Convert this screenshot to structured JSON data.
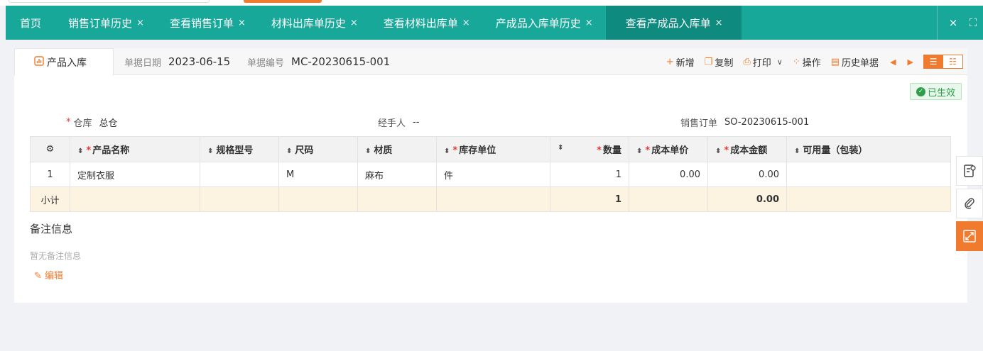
{
  "tabs": [
    {
      "label": "首页",
      "closable": false,
      "active": false
    },
    {
      "label": "销售订单历史",
      "closable": true,
      "active": false
    },
    {
      "label": "查看销售订单",
      "closable": true,
      "active": false
    },
    {
      "label": "材料出库单历史",
      "closable": true,
      "active": false
    },
    {
      "label": "查看材料出库单",
      "closable": true,
      "active": false
    },
    {
      "label": "产成品入库单历史",
      "closable": true,
      "active": false
    },
    {
      "label": "查看产成品入库单",
      "closable": true,
      "active": true
    }
  ],
  "tab_close_glyph": "×",
  "tabbar_controls": {
    "close": "×",
    "fullscreen": "⛶"
  },
  "subtab": {
    "label": "产品入库",
    "icon": "chart-icon"
  },
  "meta": {
    "date_label": "单据日期",
    "date_value": "2023-06-15",
    "number_label": "单据编号",
    "number_value": "MC-20230615-001"
  },
  "toolbar": {
    "new": "新增",
    "copy": "复制",
    "print": "打印",
    "operate": "操作",
    "history": "历史单据"
  },
  "status_badge": "已生效",
  "form": {
    "warehouse_label": "仓库",
    "warehouse_value": "总仓",
    "handler_label": "经手人",
    "handler_value": "--",
    "sales_order_label": "销售订单",
    "sales_order_value": "SO-20230615-001"
  },
  "table": {
    "headers": [
      "产品名称",
      "规格型号",
      "尺码",
      "材质",
      "库存单位",
      "数量",
      "成本单价",
      "成本金额",
      "可用量（包装）"
    ],
    "rows": [
      {
        "index": "1",
        "name": "定制衣服",
        "spec": "",
        "size": "M",
        "material": "麻布",
        "unit": "件",
        "qty": "1",
        "unit_cost": "0.00",
        "amount": "0.00",
        "available": ""
      }
    ],
    "subtotal": {
      "label": "小计",
      "qty": "1",
      "amount": "0.00"
    }
  },
  "notes": {
    "title": "备注信息",
    "empty": "暂无备注信息",
    "edit": "编辑"
  },
  "colors": {
    "accent": "#f07b2f",
    "tabbar": "#17a89a",
    "tab_active": "#0e8a7e",
    "success": "#2e9e4a",
    "subtotal_bg": "#fdf3e1"
  }
}
